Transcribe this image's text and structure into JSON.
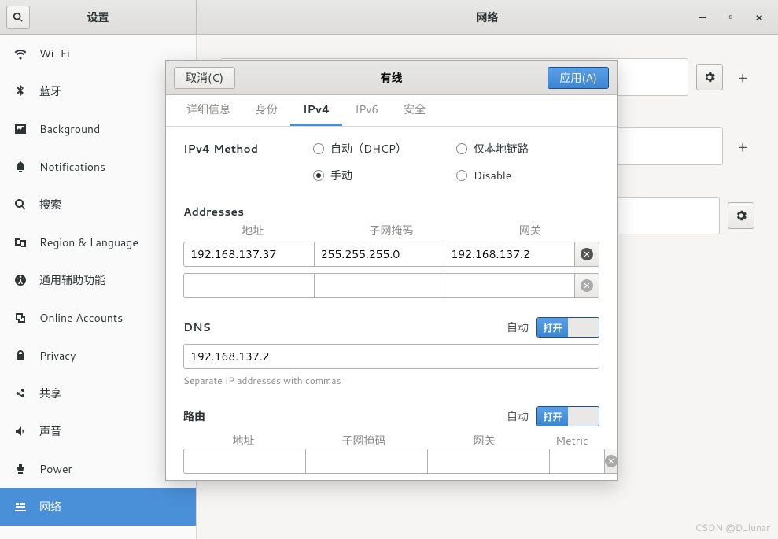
{
  "titlebar": {
    "left_title": "设置",
    "right_title": "网络"
  },
  "sidebar": {
    "items": [
      {
        "label": "Wi-Fi",
        "icon": "wifi"
      },
      {
        "label": "蓝牙",
        "icon": "bluetooth"
      },
      {
        "label": "Background",
        "icon": "background"
      },
      {
        "label": "Notifications",
        "icon": "bell"
      },
      {
        "label": "搜索",
        "icon": "search"
      },
      {
        "label": "Region & Language",
        "icon": "region"
      },
      {
        "label": "通用辅助功能",
        "icon": "accessibility"
      },
      {
        "label": "Online Accounts",
        "icon": "accounts"
      },
      {
        "label": "Privacy",
        "icon": "privacy"
      },
      {
        "label": "共享",
        "icon": "share"
      },
      {
        "label": "声音",
        "icon": "sound"
      },
      {
        "label": "Power",
        "icon": "power"
      },
      {
        "label": "网络",
        "icon": "network",
        "selected": true
      }
    ]
  },
  "dialog": {
    "cancel": "取消(C)",
    "apply": "应用(A)",
    "title": "有线",
    "tabs": [
      "详细信息",
      "身份",
      "IPv4",
      "IPv6",
      "安全"
    ],
    "active_tab": 2,
    "method_label": "IPv4 Method",
    "methods": {
      "auto": "自动（DHCP）",
      "manual": "手动",
      "link_local": "仅本地链路",
      "disable": "Disable",
      "selected": "manual"
    },
    "addresses": {
      "label": "Addresses",
      "headers": [
        "地址",
        "子网掩码",
        "网关"
      ],
      "rows": [
        {
          "addr": "192.168.137.37",
          "mask": "255.255.255.0",
          "gw": "192.168.137.2"
        },
        {
          "addr": "",
          "mask": "",
          "gw": ""
        }
      ]
    },
    "dns": {
      "label": "DNS",
      "auto_label": "自动",
      "switch_on": "打开",
      "value": "192.168.137.2",
      "hint": "Separate IP addresses with commas"
    },
    "routes": {
      "label": "路由",
      "auto_label": "自动",
      "switch_on": "打开",
      "headers": [
        "地址",
        "子网掩码",
        "网关",
        "Metric"
      ]
    }
  },
  "watermark": "CSDN @D_lunar"
}
